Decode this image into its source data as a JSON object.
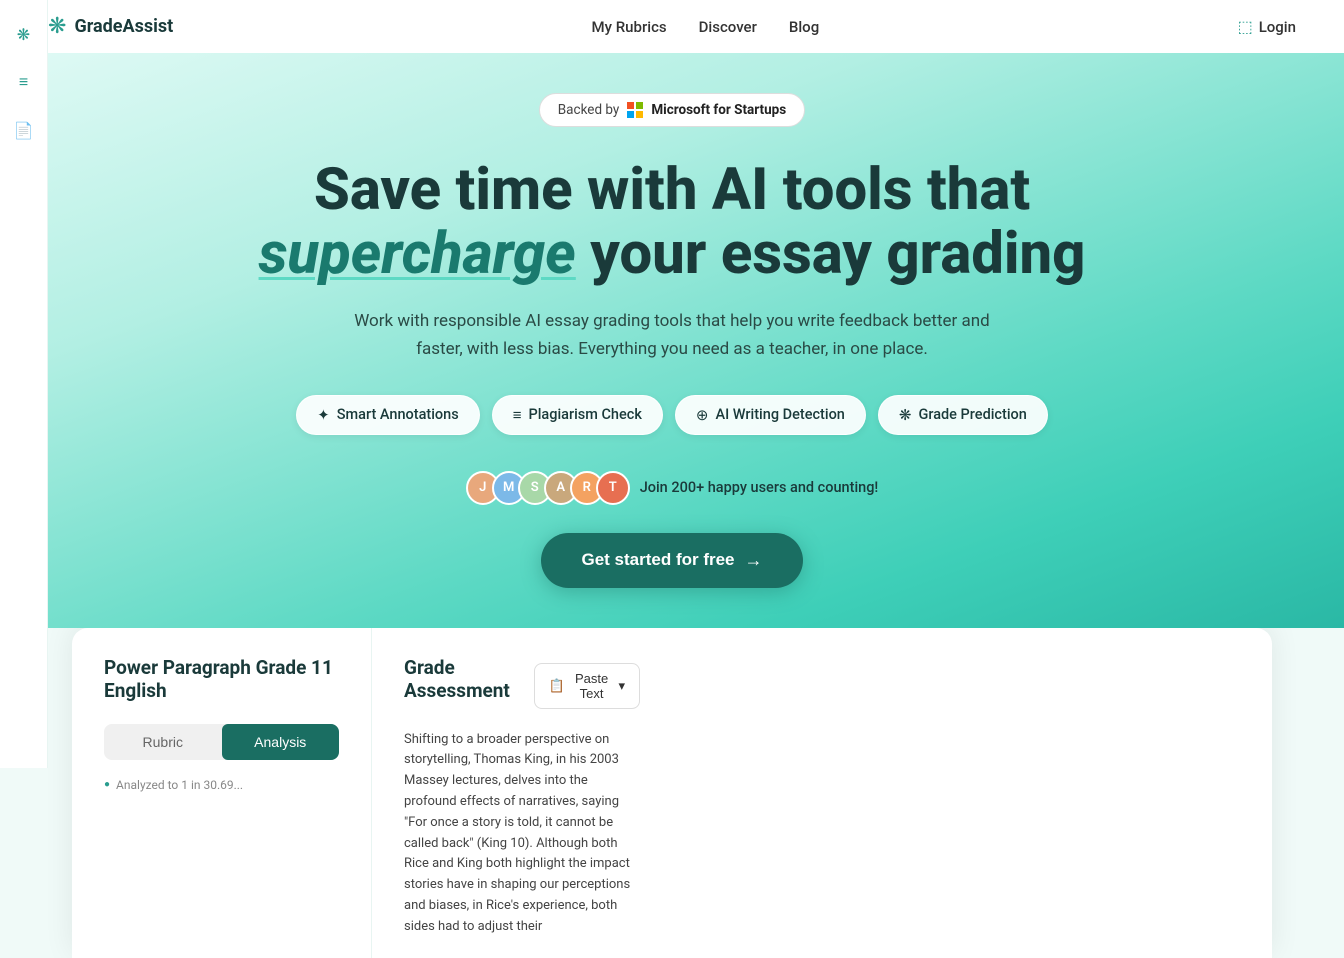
{
  "nav": {
    "logo_text": "GradeAssist",
    "links": [
      {
        "label": "My Rubrics",
        "id": "my-rubrics"
      },
      {
        "label": "Discover",
        "id": "discover"
      },
      {
        "label": "Blog",
        "id": "blog"
      }
    ],
    "login_label": "Login"
  },
  "hero": {
    "badge": {
      "prefix": "Backed by",
      "brand": "Microsoft for Startups"
    },
    "title_line1": "Save time with AI tools that",
    "title_highlight": "supercharge",
    "title_line2": " your essay grading",
    "subtitle": "Work with responsible AI essay grading tools that help you write feedback better and faster, with less bias. Everything you need as a teacher, in one place.",
    "pills": [
      {
        "icon": "✦",
        "label": "Smart Annotations"
      },
      {
        "icon": "≡",
        "label": "Plagiarism Check"
      },
      {
        "icon": "⊕",
        "label": "AI Writing Detection"
      },
      {
        "icon": "❋",
        "label": "Grade Prediction"
      }
    ],
    "users_text": "Join 200+ happy users and counting!",
    "cta_label": "Get started for free"
  },
  "preview": {
    "left": {
      "title": "Power Paragraph Grade 11 English",
      "tab_rubric": "Rubric",
      "tab_analysis": "Analysis",
      "analyzed_text": "Analyzed to 1 in 30.69..."
    },
    "right": {
      "title": "Grade Assessment",
      "paste_btn": "Paste Text",
      "content": "Shifting to a broader perspective on storytelling, Thomas King, in his 2003 Massey lectures, delves into the profound effects of narratives, saying \"For once a story is told, it cannot be called back\" (King 10). Although both Rice and King both highlight the impact stories have in shaping our perceptions and biases, in Rice's experience, both sides had to adjust their"
    }
  }
}
